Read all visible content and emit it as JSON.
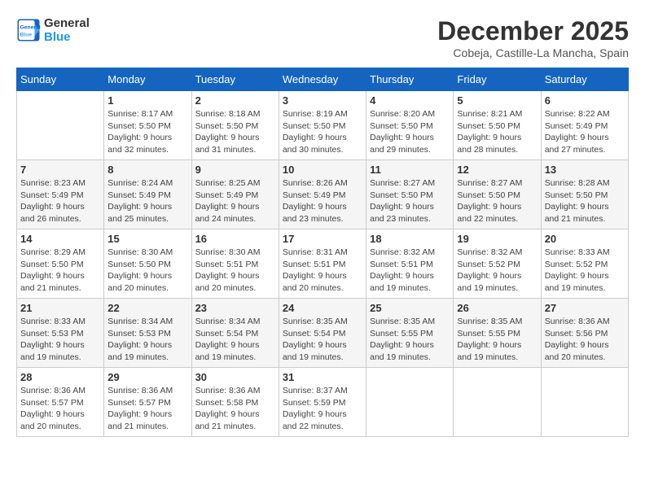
{
  "header": {
    "logo_line1": "General",
    "logo_line2": "Blue",
    "month_title": "December 2025",
    "location": "Cobeja, Castille-La Mancha, Spain"
  },
  "weekdays": [
    "Sunday",
    "Monday",
    "Tuesday",
    "Wednesday",
    "Thursday",
    "Friday",
    "Saturday"
  ],
  "weeks": [
    [
      {
        "day": "",
        "info": ""
      },
      {
        "day": "1",
        "info": "Sunrise: 8:17 AM\nSunset: 5:50 PM\nDaylight: 9 hours\nand 32 minutes."
      },
      {
        "day": "2",
        "info": "Sunrise: 8:18 AM\nSunset: 5:50 PM\nDaylight: 9 hours\nand 31 minutes."
      },
      {
        "day": "3",
        "info": "Sunrise: 8:19 AM\nSunset: 5:50 PM\nDaylight: 9 hours\nand 30 minutes."
      },
      {
        "day": "4",
        "info": "Sunrise: 8:20 AM\nSunset: 5:50 PM\nDaylight: 9 hours\nand 29 minutes."
      },
      {
        "day": "5",
        "info": "Sunrise: 8:21 AM\nSunset: 5:50 PM\nDaylight: 9 hours\nand 28 minutes."
      },
      {
        "day": "6",
        "info": "Sunrise: 8:22 AM\nSunset: 5:49 PM\nDaylight: 9 hours\nand 27 minutes."
      }
    ],
    [
      {
        "day": "7",
        "info": "Sunrise: 8:23 AM\nSunset: 5:49 PM\nDaylight: 9 hours\nand 26 minutes."
      },
      {
        "day": "8",
        "info": "Sunrise: 8:24 AM\nSunset: 5:49 PM\nDaylight: 9 hours\nand 25 minutes."
      },
      {
        "day": "9",
        "info": "Sunrise: 8:25 AM\nSunset: 5:49 PM\nDaylight: 9 hours\nand 24 minutes."
      },
      {
        "day": "10",
        "info": "Sunrise: 8:26 AM\nSunset: 5:49 PM\nDaylight: 9 hours\nand 23 minutes."
      },
      {
        "day": "11",
        "info": "Sunrise: 8:27 AM\nSunset: 5:50 PM\nDaylight: 9 hours\nand 23 minutes."
      },
      {
        "day": "12",
        "info": "Sunrise: 8:27 AM\nSunset: 5:50 PM\nDaylight: 9 hours\nand 22 minutes."
      },
      {
        "day": "13",
        "info": "Sunrise: 8:28 AM\nSunset: 5:50 PM\nDaylight: 9 hours\nand 21 minutes."
      }
    ],
    [
      {
        "day": "14",
        "info": "Sunrise: 8:29 AM\nSunset: 5:50 PM\nDaylight: 9 hours\nand 21 minutes."
      },
      {
        "day": "15",
        "info": "Sunrise: 8:30 AM\nSunset: 5:50 PM\nDaylight: 9 hours\nand 20 minutes."
      },
      {
        "day": "16",
        "info": "Sunrise: 8:30 AM\nSunset: 5:51 PM\nDaylight: 9 hours\nand 20 minutes."
      },
      {
        "day": "17",
        "info": "Sunrise: 8:31 AM\nSunset: 5:51 PM\nDaylight: 9 hours\nand 20 minutes."
      },
      {
        "day": "18",
        "info": "Sunrise: 8:32 AM\nSunset: 5:51 PM\nDaylight: 9 hours\nand 19 minutes."
      },
      {
        "day": "19",
        "info": "Sunrise: 8:32 AM\nSunset: 5:52 PM\nDaylight: 9 hours\nand 19 minutes."
      },
      {
        "day": "20",
        "info": "Sunrise: 8:33 AM\nSunset: 5:52 PM\nDaylight: 9 hours\nand 19 minutes."
      }
    ],
    [
      {
        "day": "21",
        "info": "Sunrise: 8:33 AM\nSunset: 5:53 PM\nDaylight: 9 hours\nand 19 minutes."
      },
      {
        "day": "22",
        "info": "Sunrise: 8:34 AM\nSunset: 5:53 PM\nDaylight: 9 hours\nand 19 minutes."
      },
      {
        "day": "23",
        "info": "Sunrise: 8:34 AM\nSunset: 5:54 PM\nDaylight: 9 hours\nand 19 minutes."
      },
      {
        "day": "24",
        "info": "Sunrise: 8:35 AM\nSunset: 5:54 PM\nDaylight: 9 hours\nand 19 minutes."
      },
      {
        "day": "25",
        "info": "Sunrise: 8:35 AM\nSunset: 5:55 PM\nDaylight: 9 hours\nand 19 minutes."
      },
      {
        "day": "26",
        "info": "Sunrise: 8:35 AM\nSunset: 5:55 PM\nDaylight: 9 hours\nand 19 minutes."
      },
      {
        "day": "27",
        "info": "Sunrise: 8:36 AM\nSunset: 5:56 PM\nDaylight: 9 hours\nand 20 minutes."
      }
    ],
    [
      {
        "day": "28",
        "info": "Sunrise: 8:36 AM\nSunset: 5:57 PM\nDaylight: 9 hours\nand 20 minutes."
      },
      {
        "day": "29",
        "info": "Sunrise: 8:36 AM\nSunset: 5:57 PM\nDaylight: 9 hours\nand 21 minutes."
      },
      {
        "day": "30",
        "info": "Sunrise: 8:36 AM\nSunset: 5:58 PM\nDaylight: 9 hours\nand 21 minutes."
      },
      {
        "day": "31",
        "info": "Sunrise: 8:37 AM\nSunset: 5:59 PM\nDaylight: 9 hours\nand 22 minutes."
      },
      {
        "day": "",
        "info": ""
      },
      {
        "day": "",
        "info": ""
      },
      {
        "day": "",
        "info": ""
      }
    ]
  ]
}
